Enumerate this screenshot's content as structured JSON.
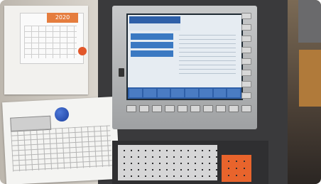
{
  "photo": {
    "calendar": {
      "year": "2020",
      "side_labels": [
        "",
        ""
      ]
    },
    "screen": {
      "title": "",
      "subtitle": "",
      "positions": [
        "",
        "",
        ""
      ]
    },
    "colors": {
      "screen_header": "#2e5fa8",
      "position_field": "#3b79c2",
      "calendar_accent": "#e57d3e",
      "orange_keys": "#e8642c",
      "blue_magnet": "#1b3f9f"
    }
  }
}
